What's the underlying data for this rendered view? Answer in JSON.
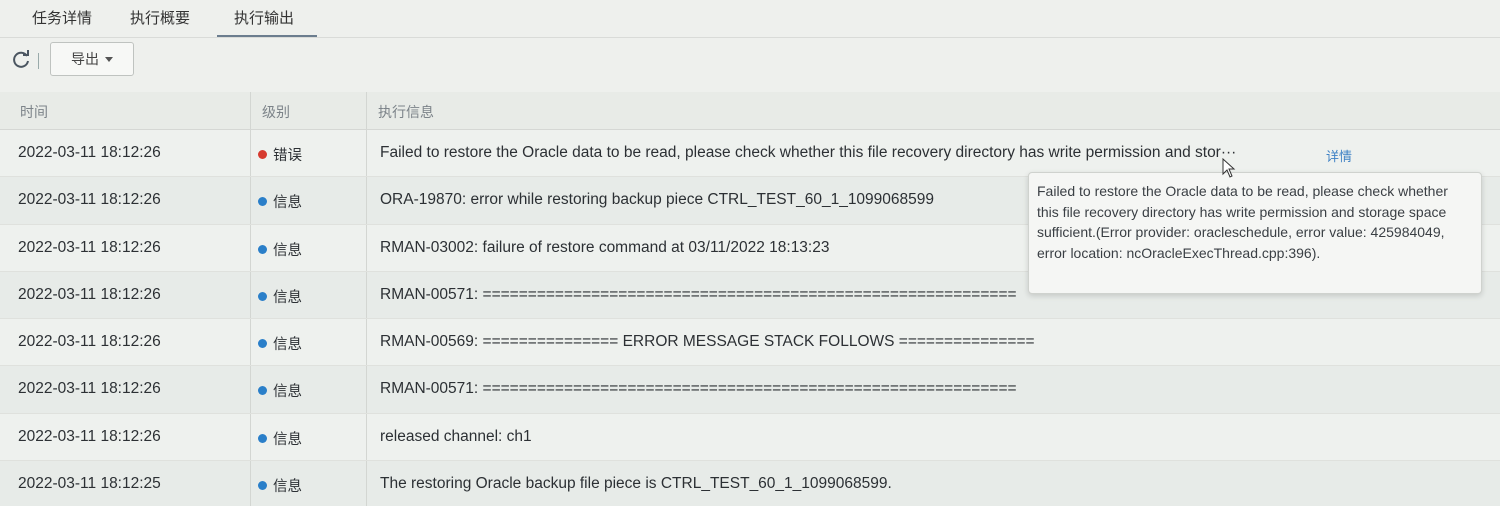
{
  "tabs": [
    {
      "label": "任务详情",
      "active": false
    },
    {
      "label": "执行概要",
      "active": false
    },
    {
      "label": "执行输出",
      "active": true
    }
  ],
  "toolbar": {
    "refresh_icon": "refresh-icon",
    "export_label": "导出"
  },
  "table": {
    "headers": [
      "时间",
      "级别",
      "执行信息"
    ],
    "rows": [
      {
        "time": "2022-03-11 18:12:26",
        "level": "错误",
        "level_color": "#d63b2f",
        "message": "Failed to restore the Oracle data to be read, please check whether this file recovery directory has write permission and stor···",
        "detail": "详情"
      },
      {
        "time": "2022-03-11 18:12:26",
        "level": "信息",
        "level_color": "#2a7fc9",
        "message": "ORA-19870: error while restoring backup piece CTRL_TEST_60_1_1099068599"
      },
      {
        "time": "2022-03-11 18:12:26",
        "level": "信息",
        "level_color": "#2a7fc9",
        "message": "RMAN-03002: failure of restore command at 03/11/2022 18:13:23"
      },
      {
        "time": "2022-03-11 18:12:26",
        "level": "信息",
        "level_color": "#2a7fc9",
        "message": "RMAN-00571: ==========================================================="
      },
      {
        "time": "2022-03-11 18:12:26",
        "level": "信息",
        "level_color": "#2a7fc9",
        "message": "RMAN-00569: =============== ERROR MESSAGE STACK FOLLOWS ==============="
      },
      {
        "time": "2022-03-11 18:12:26",
        "level": "信息",
        "level_color": "#2a7fc9",
        "message": "RMAN-00571: ==========================================================="
      },
      {
        "time": "2022-03-11 18:12:26",
        "level": "信息",
        "level_color": "#2a7fc9",
        "message": "released channel: ch1"
      },
      {
        "time": "2022-03-11 18:12:25",
        "level": "信息",
        "level_color": "#2a7fc9",
        "message": "The restoring Oracle backup file piece is CTRL_TEST_60_1_1099068599."
      }
    ]
  },
  "tooltip": {
    "text": "Failed to restore the Oracle data to be read, please check whether this file recovery directory has write permission and storage space sufficient.(Error provider: oracleschedule, error value: 425984049, error location: ncOracleExecThread.cpp:396)."
  }
}
